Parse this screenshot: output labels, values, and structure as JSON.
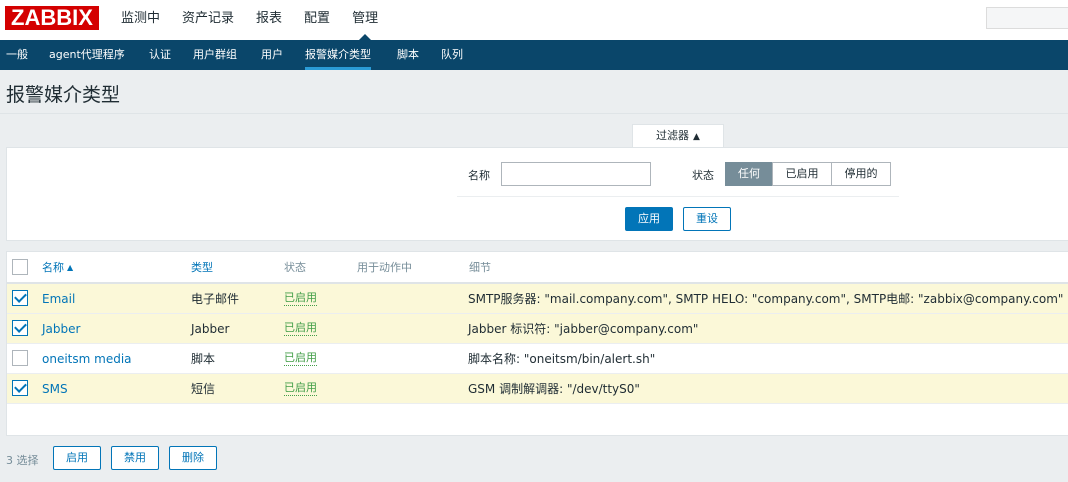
{
  "app": {
    "logo": "ZABBIX"
  },
  "top_menu": [
    "监测中",
    "资产记录",
    "报表",
    "配置",
    "管理"
  ],
  "top_menu_active": "管理",
  "sub_menu": [
    "一般",
    "agent代理程序",
    "认证",
    "用户群组",
    "用户",
    "报警媒介类型",
    "脚本",
    "队列"
  ],
  "sub_menu_active": "报警媒介类型",
  "page_title": "报警媒介类型",
  "filter": {
    "tab_label": "过滤器",
    "tab_arrow": "▲",
    "name_label": "名称",
    "name_value": "",
    "status_label": "状态",
    "status_options": [
      "任何",
      "已启用",
      "停用的"
    ],
    "status_selected": "任何",
    "apply_label": "应用",
    "reset_label": "重设"
  },
  "table": {
    "headers": {
      "name": "名称",
      "sort_arrow": "▲",
      "type": "类型",
      "status": "状态",
      "used_in_actions": "用于动作中",
      "details": "细节"
    },
    "rows": [
      {
        "checked": true,
        "name": "Email",
        "type": "电子邮件",
        "status": "已启用",
        "used": "",
        "details": "SMTP服务器: \"mail.company.com\", SMTP HELO: \"company.com\", SMTP电邮: \"zabbix@company.com\""
      },
      {
        "checked": true,
        "name": "Jabber",
        "type": "Jabber",
        "status": "已启用",
        "used": "",
        "details": "Jabber 标识符: \"jabber@company.com\""
      },
      {
        "checked": false,
        "name": "oneitsm media",
        "type": "脚本",
        "status": "已启用",
        "used": "",
        "details": "脚本名称: \"oneitsm/bin/alert.sh\""
      },
      {
        "checked": true,
        "name": "SMS",
        "type": "短信",
        "status": "已启用",
        "used": "",
        "details": "GSM 调制解调器: \"/dev/ttyS0\""
      }
    ]
  },
  "footer": {
    "selected_count": "3 选择",
    "enable_label": "启用",
    "disable_label": "禁用",
    "delete_label": "删除"
  },
  "colors": {
    "brand": "#d40000",
    "nav_bg": "#0a466a",
    "link": "#0275b8",
    "enabled": "#429e47",
    "selected_row": "#fbf8d8"
  }
}
